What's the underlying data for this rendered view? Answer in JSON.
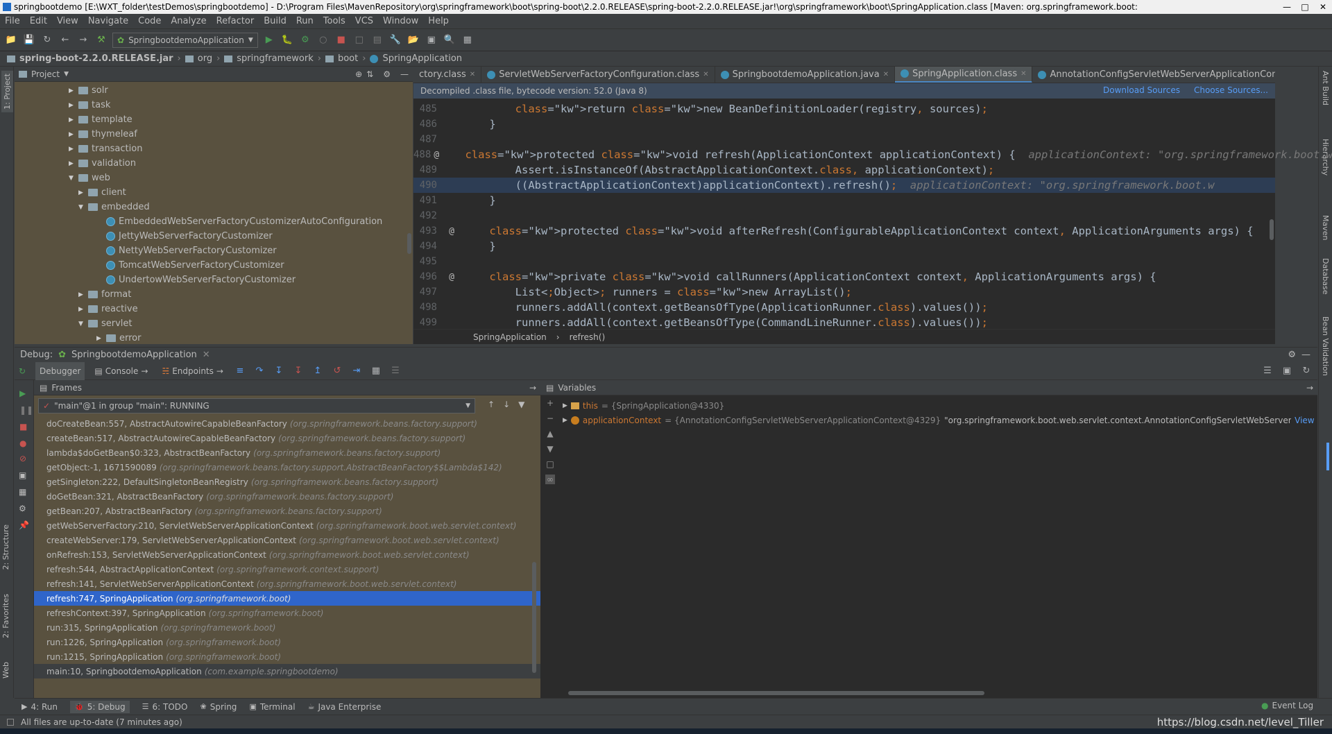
{
  "window": {
    "title": "springbootdemo [E:\\WXT_folder\\testDemos\\springbootdemo] - D:\\Program Files\\MavenRepository\\org\\springframework\\boot\\spring-boot\\2.2.0.RELEASE\\spring-boot-2.2.0.RELEASE.jar!\\org\\springframework\\boot\\SpringApplication.class [Maven: org.springframework.boot:"
  },
  "menu": [
    "File",
    "Edit",
    "View",
    "Navigate",
    "Code",
    "Analyze",
    "Refactor",
    "Build",
    "Run",
    "Tools",
    "VCS",
    "Window",
    "Help"
  ],
  "toolbar": {
    "run_config": "SpringbootdemoApplication"
  },
  "navbar": [
    "spring-boot-2.2.0.RELEASE.jar",
    "org",
    "springframework",
    "boot",
    "SpringApplication"
  ],
  "left_strip": {
    "project": "1: Project",
    "structure": "2: Structure",
    "favorites": "2: Favorites",
    "web": "Web"
  },
  "right_strip": {
    "ant": "Ant Build",
    "hierarchy": "Hierarchy",
    "maven": "Maven",
    "database": "Database",
    "bean": "Bean Validation"
  },
  "project": {
    "title": "Project",
    "items": [
      {
        "label": "solr",
        "type": "folder",
        "indent": 0,
        "arrow": "right"
      },
      {
        "label": "task",
        "type": "folder",
        "indent": 0,
        "arrow": "right"
      },
      {
        "label": "template",
        "type": "folder",
        "indent": 0,
        "arrow": "right"
      },
      {
        "label": "thymeleaf",
        "type": "folder",
        "indent": 0,
        "arrow": "right"
      },
      {
        "label": "transaction",
        "type": "folder",
        "indent": 0,
        "arrow": "right"
      },
      {
        "label": "validation",
        "type": "folder",
        "indent": 0,
        "arrow": "right"
      },
      {
        "label": "web",
        "type": "folder",
        "indent": 0,
        "arrow": "down"
      },
      {
        "label": "client",
        "type": "folder",
        "indent": 1,
        "arrow": "right"
      },
      {
        "label": "embedded",
        "type": "folder",
        "indent": 1,
        "arrow": "down"
      },
      {
        "label": "EmbeddedWebServerFactoryCustomizerAutoConfiguration",
        "type": "class",
        "indent": 2,
        "arrow": ""
      },
      {
        "label": "JettyWebServerFactoryCustomizer",
        "type": "class",
        "indent": 2,
        "arrow": ""
      },
      {
        "label": "NettyWebServerFactoryCustomizer",
        "type": "class",
        "indent": 2,
        "arrow": ""
      },
      {
        "label": "TomcatWebServerFactoryCustomizer",
        "type": "class",
        "indent": 2,
        "arrow": ""
      },
      {
        "label": "UndertowWebServerFactoryCustomizer",
        "type": "class",
        "indent": 2,
        "arrow": ""
      },
      {
        "label": "format",
        "type": "folder",
        "indent": 1,
        "arrow": "right"
      },
      {
        "label": "reactive",
        "type": "folder",
        "indent": 1,
        "arrow": "right"
      },
      {
        "label": "servlet",
        "type": "folder",
        "indent": 1,
        "arrow": "down"
      },
      {
        "label": "error",
        "type": "folder",
        "indent": 2,
        "arrow": "right"
      }
    ]
  },
  "editor": {
    "tabs": [
      {
        "label": "ctory.class",
        "active": false
      },
      {
        "label": "ServletWebServerFactoryConfiguration.class",
        "active": false
      },
      {
        "label": "SpringbootdemoApplication.java",
        "active": false
      },
      {
        "label": "SpringApplication.class",
        "active": true
      },
      {
        "label": "AnnotationConfigServletWebServerApplicationContext.class",
        "active": false
      }
    ],
    "tab_overflow": "6",
    "decompiled_notice": "Decompiled .class file, bytecode version: 52.0 (Java 8)",
    "download_sources": "Download Sources",
    "choose_sources": "Choose Sources...",
    "lines": [
      {
        "n": "485",
        "gutter": "",
        "sel": false,
        "code": "        return new BeanDefinitionLoader(registry, sources);",
        "hint": ""
      },
      {
        "n": "486",
        "gutter": "",
        "sel": false,
        "code": "    }",
        "hint": ""
      },
      {
        "n": "487",
        "gutter": "",
        "sel": false,
        "code": "",
        "hint": ""
      },
      {
        "n": "488",
        "gutter": "@",
        "sel": false,
        "code": "    protected void refresh(ApplicationContext applicationContext) {",
        "hint": "  applicationContext: \"org.springframework.boot.w"
      },
      {
        "n": "489",
        "gutter": "",
        "sel": false,
        "code": "        Assert.isInstanceOf(AbstractApplicationContext.class, applicationContext);",
        "hint": ""
      },
      {
        "n": "490",
        "gutter": "",
        "sel": true,
        "code": "        ((AbstractApplicationContext)applicationContext).refresh();",
        "hint": "  applicationContext: \"org.springframework.boot.w"
      },
      {
        "n": "491",
        "gutter": "",
        "sel": false,
        "code": "    }",
        "hint": ""
      },
      {
        "n": "492",
        "gutter": "",
        "sel": false,
        "code": "",
        "hint": ""
      },
      {
        "n": "493",
        "gutter": "@",
        "sel": false,
        "code": "    protected void afterRefresh(ConfigurableApplicationContext context, ApplicationArguments args) {",
        "hint": ""
      },
      {
        "n": "494",
        "gutter": "",
        "sel": false,
        "code": "    }",
        "hint": ""
      },
      {
        "n": "495",
        "gutter": "",
        "sel": false,
        "code": "",
        "hint": ""
      },
      {
        "n": "496",
        "gutter": "@",
        "sel": false,
        "code": "    private void callRunners(ApplicationContext context, ApplicationArguments args) {",
        "hint": ""
      },
      {
        "n": "497",
        "gutter": "",
        "sel": false,
        "code": "        List<Object> runners = new ArrayList();",
        "hint": ""
      },
      {
        "n": "498",
        "gutter": "",
        "sel": false,
        "code": "        runners.addAll(context.getBeansOfType(ApplicationRunner.class).values());",
        "hint": ""
      },
      {
        "n": "499",
        "gutter": "",
        "sel": false,
        "code": "        runners.addAll(context.getBeansOfType(CommandLineRunner.class).values());",
        "hint": ""
      }
    ],
    "breadcrumb": [
      "SpringApplication",
      "refresh()"
    ]
  },
  "debug": {
    "label": "Debug:",
    "session": "SpringbootdemoApplication",
    "tabs": [
      "Debugger",
      "Console",
      "Endpoints"
    ],
    "frames_title": "Frames",
    "variables_title": "Variables",
    "thread": "\"main\"@1 in group \"main\": RUNNING",
    "frames": [
      {
        "m": "doCreateBean:557, AbstractAutowireCapableBeanFactory",
        "p": "(org.springframework.beans.factory.support)"
      },
      {
        "m": "createBean:517, AbstractAutowireCapableBeanFactory",
        "p": "(org.springframework.beans.factory.support)"
      },
      {
        "m": "lambda$doGetBean$0:323, AbstractBeanFactory",
        "p": "(org.springframework.beans.factory.support)"
      },
      {
        "m": "getObject:-1, 1671590089",
        "p": "(org.springframework.beans.factory.support.AbstractBeanFactory$$Lambda$142)"
      },
      {
        "m": "getSingleton:222, DefaultSingletonBeanRegistry",
        "p": "(org.springframework.beans.factory.support)"
      },
      {
        "m": "doGetBean:321, AbstractBeanFactory",
        "p": "(org.springframework.beans.factory.support)"
      },
      {
        "m": "getBean:207, AbstractBeanFactory",
        "p": "(org.springframework.beans.factory.support)"
      },
      {
        "m": "getWebServerFactory:210, ServletWebServerApplicationContext",
        "p": "(org.springframework.boot.web.servlet.context)"
      },
      {
        "m": "createWebServer:179, ServletWebServerApplicationContext",
        "p": "(org.springframework.boot.web.servlet.context)"
      },
      {
        "m": "onRefresh:153, ServletWebServerApplicationContext",
        "p": "(org.springframework.boot.web.servlet.context)"
      },
      {
        "m": "refresh:544, AbstractApplicationContext",
        "p": "(org.springframework.context.support)"
      },
      {
        "m": "refresh:141, ServletWebServerApplicationContext",
        "p": "(org.springframework.boot.web.servlet.context)"
      },
      {
        "m": "refresh:747, SpringApplication",
        "p": "(org.springframework.boot)",
        "sel": true
      },
      {
        "m": "refreshContext:397, SpringApplication",
        "p": "(org.springframework.boot)"
      },
      {
        "m": "run:315, SpringApplication",
        "p": "(org.springframework.boot)"
      },
      {
        "m": "run:1226, SpringApplication",
        "p": "(org.springframework.boot)"
      },
      {
        "m": "run:1215, SpringApplication",
        "p": "(org.springframework.boot)"
      },
      {
        "m": "main:10, SpringbootdemoApplication",
        "p": "(com.example.springbootdemo)",
        "last": true
      }
    ],
    "variables": [
      {
        "name": "this",
        "value": "= {SpringApplication@4330}",
        "str": "",
        "icon": "list"
      },
      {
        "name": "applicationContext",
        "value": "= {AnnotationConfigServletWebServerApplicationContext@4329}",
        "str": " \"org.springframework.boot.web.servlet.context.AnnotationConfigServletWebServerApplica...",
        "view": "View",
        "icon": "param"
      }
    ]
  },
  "bottom_tabs": [
    "4: Run",
    "5: Debug",
    "6: TODO",
    "Spring",
    "Terminal",
    "Java Enterprise"
  ],
  "event_log": "Event Log",
  "status": "All files are up-to-date (7 minutes ago)",
  "watermark": "https://blog.csdn.net/level_Tiller"
}
